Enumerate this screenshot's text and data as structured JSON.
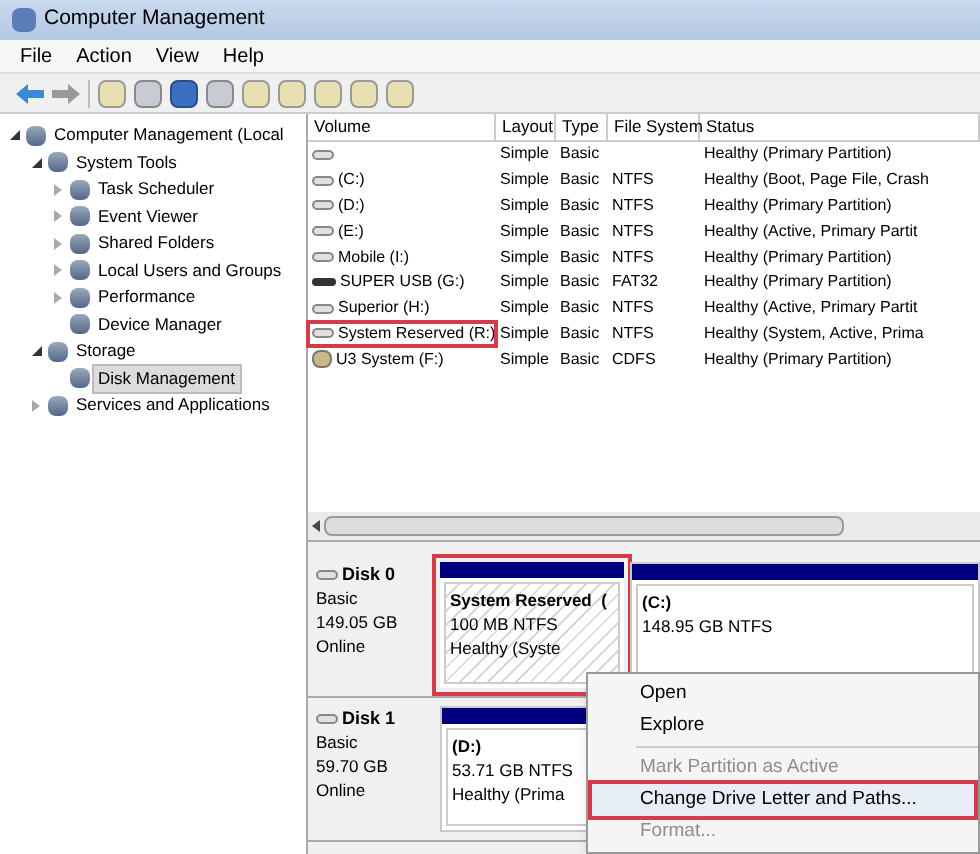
{
  "window": {
    "title": "Computer Management"
  },
  "menu": [
    "File",
    "Action",
    "View",
    "Help"
  ],
  "tree": [
    {
      "label": "Computer Management (Local",
      "expanded": true,
      "selected": false,
      "children": [
        {
          "label": "System Tools",
          "expanded": true,
          "selected": false,
          "children": [
            {
              "label": "Task Scheduler",
              "expanded": false,
              "selected": false
            },
            {
              "label": "Event Viewer",
              "expanded": false,
              "selected": false
            },
            {
              "label": "Shared Folders",
              "expanded": false,
              "selected": false
            },
            {
              "label": "Local Users and Groups",
              "expanded": false,
              "selected": false
            },
            {
              "label": "Performance",
              "expanded": false,
              "selected": false
            },
            {
              "label": "Device Manager",
              "selected": false
            }
          ]
        },
        {
          "label": "Storage",
          "expanded": true,
          "selected": false,
          "children": [
            {
              "label": "Disk Management",
              "selected": true
            }
          ]
        },
        {
          "label": "Services and Applications",
          "expanded": false,
          "selected": false
        }
      ]
    }
  ],
  "table": {
    "columns": [
      "Volume",
      "Layout",
      "Type",
      "File System",
      "Status"
    ],
    "rows": [
      {
        "kind": "disk",
        "highlighted": false,
        "layout": "Simple",
        "type": "Basic",
        "status": "Healthy (Primary Partition)"
      },
      {
        "kind": "disk",
        "highlighted": false,
        "volume": "(C:)",
        "layout": "Simple",
        "type": "Basic",
        "file_system": "NTFS",
        "status": "Healthy (Boot, Page File, Crash"
      },
      {
        "kind": "disk",
        "highlighted": false,
        "volume": "(D:)",
        "layout": "Simple",
        "type": "Basic",
        "file_system": "NTFS",
        "status": "Healthy (Primary Partition)"
      },
      {
        "kind": "disk",
        "highlighted": false,
        "volume": "(E:)",
        "layout": "Simple",
        "type": "Basic",
        "file_system": "NTFS",
        "status": "Healthy (Active, Primary Partit"
      },
      {
        "kind": "disk",
        "highlighted": false,
        "volume": "Mobile (I:)",
        "layout": "Simple",
        "type": "Basic",
        "file_system": "NTFS",
        "status": "Healthy (Primary Partition)"
      },
      {
        "kind": "usb",
        "highlighted": false,
        "volume": "SUPER USB (G:)",
        "layout": "Simple",
        "type": "Basic",
        "file_system": "FAT32",
        "status": "Healthy (Primary Partition)"
      },
      {
        "kind": "disk",
        "highlighted": false,
        "volume": "Superior (H:)",
        "layout": "Simple",
        "type": "Basic",
        "file_system": "NTFS",
        "status": "Healthy (Active, Primary Partit"
      },
      {
        "kind": "disk",
        "highlighted": true,
        "volume": "System Reserved (R:)",
        "layout": "Simple",
        "type": "Basic",
        "file_system": "NTFS",
        "status": "Healthy (System, Active, Prima"
      },
      {
        "kind": "cd",
        "highlighted": false,
        "volume": "U3 System (F:)",
        "layout": "Simple",
        "type": "Basic",
        "file_system": "CDFS",
        "status": "Healthy (Primary Partition)"
      }
    ]
  },
  "disks": [
    {
      "name": "Disk 0",
      "type": "Basic",
      "size": "149.05 GB",
      "state": "Online",
      "partitions": [
        {
          "name": "System Reserved  (",
          "size": "100 MB NTFS",
          "status": "Healthy (Syste",
          "hatched": true,
          "highlighted": true
        },
        {
          "name": "(C:)",
          "size": "148.95 GB NTFS",
          "hatched": false,
          "highlighted": false
        }
      ]
    },
    {
      "name": "Disk 1",
      "type": "Basic",
      "size": "59.70 GB",
      "state": "Online",
      "partitions": [
        {
          "name": "(D:)",
          "size": "53.71 GB NTFS",
          "status": "Healthy (Prima",
          "hatched": false,
          "highlighted": false
        }
      ]
    }
  ],
  "context_menu": [
    {
      "label": "Open",
      "disabled": false,
      "highlighted": false
    },
    {
      "label": "Explore",
      "disabled": false,
      "highlighted": false
    },
    {
      "kind": "separator"
    },
    {
      "label": "Mark Partition as Active",
      "disabled": true,
      "highlighted": false
    },
    {
      "label": "Change Drive Letter and Paths...",
      "disabled": false,
      "highlighted": true
    },
    {
      "label": "Format...",
      "disabled": true,
      "highlighted": false
    }
  ]
}
